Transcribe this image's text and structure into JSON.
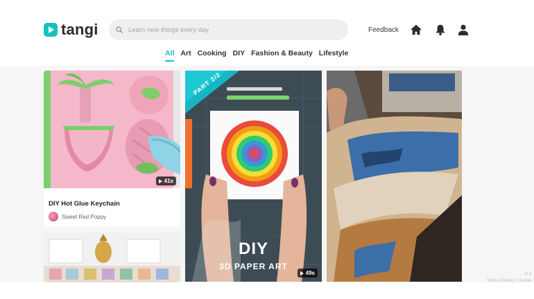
{
  "header": {
    "logo_text": "tangi",
    "search_placeholder": "Learn new things every day",
    "feedback_label": "Feedback",
    "icons": [
      "home-icon",
      "bell-icon",
      "user-icon"
    ]
  },
  "categories": [
    "All",
    "Art",
    "Cooking",
    "DIY",
    "Fashion & Beauty",
    "Lifestyle"
  ],
  "active_category": "All",
  "cards": [
    {
      "title": "DIY Hot Glue Keychain",
      "author": "Sweet Red Poppy",
      "duration": "41s"
    },
    {
      "overlay_part": "PART 2/2",
      "overlay_title": "DIY",
      "overlay_subtitle": "3D PAPER ART",
      "duration": "49s"
    }
  ],
  "footer": {
    "line1": "© 2",
    "line2": "Terms | Privacy | Cookie"
  },
  "colors": {
    "accent": "#16c1bd",
    "background": "#f6f6f6"
  }
}
